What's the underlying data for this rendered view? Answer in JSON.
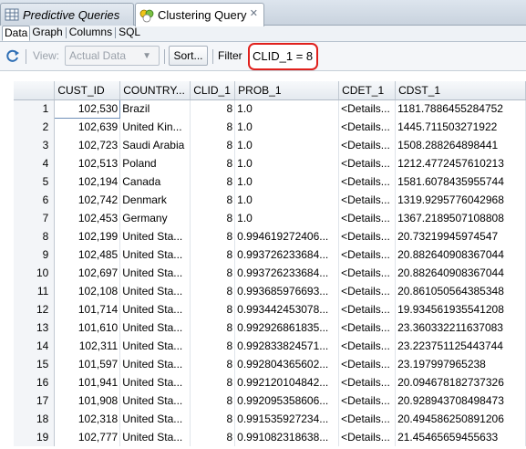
{
  "tabs": [
    {
      "label": "Predictive Queries",
      "active": false,
      "icon": "grid-icon"
    },
    {
      "label": "Clustering Query",
      "active": true,
      "icon": "clustering-icon"
    }
  ],
  "close_glyph": "✕",
  "subtabs": [
    "Data",
    "Graph",
    "Columns",
    "SQL"
  ],
  "toolbar": {
    "view_label": "View:",
    "view_value": "Actual Data",
    "sort_label": "Sort...",
    "filter_label": "Filter",
    "filter_value": "CLID_1 = 8"
  },
  "colors": {
    "highlight": "#e0201c",
    "header_bg": "#e4e9ef",
    "tab_bar": "#c9d3de"
  },
  "table": {
    "columns": [
      "CUST_ID",
      "COUNTRY...",
      "CLID_1",
      "PROB_1",
      "CDET_1",
      "CDST_1"
    ],
    "rows": [
      [
        "1",
        "102,530",
        "Brazil",
        "8",
        "1.0",
        "<Details...",
        "1181.7886455284752"
      ],
      [
        "2",
        "102,639",
        "United Kin...",
        "8",
        "1.0",
        "<Details...",
        "1445.711503271922"
      ],
      [
        "3",
        "102,723",
        "Saudi Arabia",
        "8",
        "1.0",
        "<Details...",
        "1508.288264898441"
      ],
      [
        "4",
        "102,513",
        "Poland",
        "8",
        "1.0",
        "<Details...",
        "1212.4772457610213"
      ],
      [
        "5",
        "102,194",
        "Canada",
        "8",
        "1.0",
        "<Details...",
        "1581.6078435955744"
      ],
      [
        "6",
        "102,742",
        "Denmark",
        "8",
        "1.0",
        "<Details...",
        "1319.9295776042968"
      ],
      [
        "7",
        "102,453",
        "Germany",
        "8",
        "1.0",
        "<Details...",
        "1367.2189507108808"
      ],
      [
        "8",
        "102,199",
        "United Sta...",
        "8",
        "0.994619272406...",
        "<Details...",
        "20.73219945974547"
      ],
      [
        "9",
        "102,485",
        "United Sta...",
        "8",
        "0.993726233684...",
        "<Details...",
        "20.882640908367044"
      ],
      [
        "10",
        "102,697",
        "United Sta...",
        "8",
        "0.993726233684...",
        "<Details...",
        "20.882640908367044"
      ],
      [
        "11",
        "102,108",
        "United Sta...",
        "8",
        "0.993685976693...",
        "<Details...",
        "20.861050564385348"
      ],
      [
        "12",
        "101,714",
        "United Sta...",
        "8",
        "0.993442453078...",
        "<Details...",
        "19.934561935541208"
      ],
      [
        "13",
        "101,610",
        "United Sta...",
        "8",
        "0.992926861835...",
        "<Details...",
        "23.360332211637083"
      ],
      [
        "14",
        "102,311",
        "United Sta...",
        "8",
        "0.992833824571...",
        "<Details...",
        "23.223751125443744"
      ],
      [
        "15",
        "101,597",
        "United Sta...",
        "8",
        "0.992804365602...",
        "<Details...",
        "23.197997965238"
      ],
      [
        "16",
        "101,941",
        "United Sta...",
        "8",
        "0.992120104842...",
        "<Details...",
        "20.094678182737326"
      ],
      [
        "17",
        "101,908",
        "United Sta...",
        "8",
        "0.992095358606...",
        "<Details...",
        "20.928943708498473"
      ],
      [
        "18",
        "102,318",
        "United Sta...",
        "8",
        "0.991535927234...",
        "<Details...",
        "20.494586250891206"
      ],
      [
        "19",
        "102,777",
        "United Sta...",
        "8",
        "0.991082318638...",
        "<Details...",
        "21.45465659455633"
      ]
    ]
  }
}
